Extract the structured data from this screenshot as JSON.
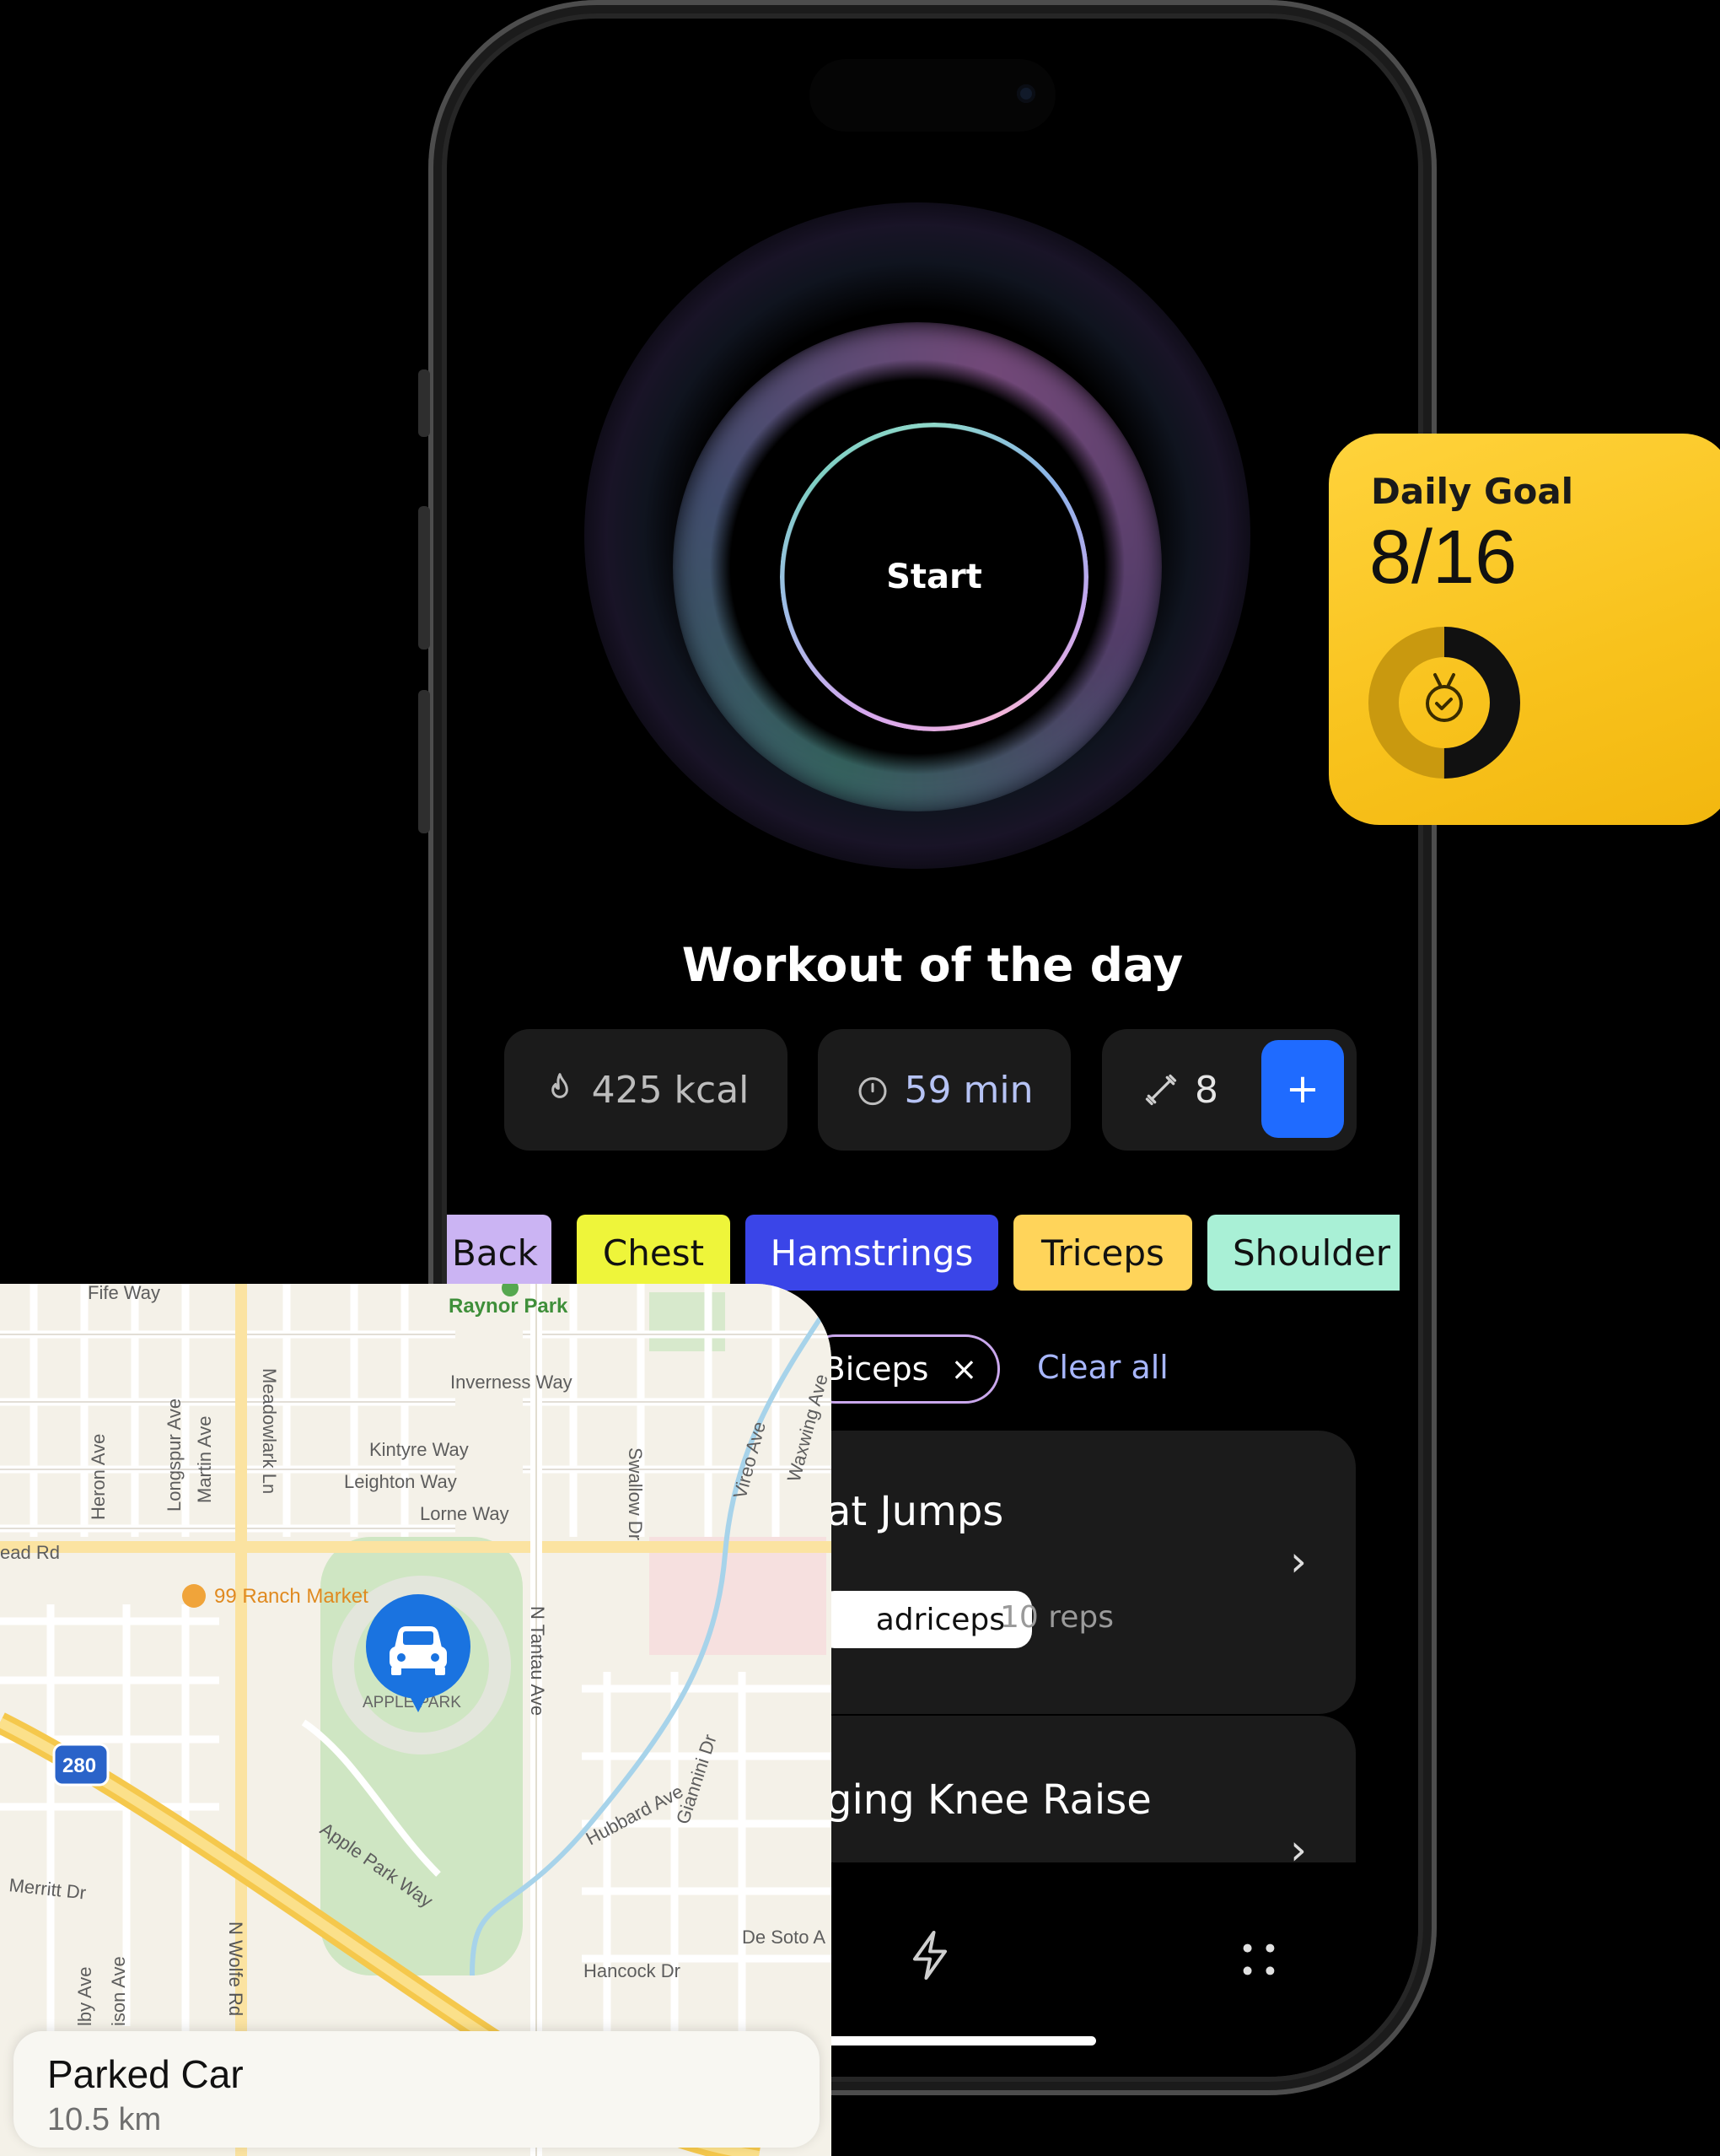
{
  "workout": {
    "start_label": "Start",
    "title": "Workout of the day",
    "stats": {
      "kcal": "425 kcal",
      "minutes": "59 min",
      "exercises": "8",
      "add_label": "+"
    },
    "categories": [
      {
        "label": "Back",
        "color": "#cbb4f3"
      },
      {
        "label": "Chest",
        "color": "#eef53a"
      },
      {
        "label": "Hamstrings",
        "color": "#3a45e8"
      },
      {
        "label": "Triceps",
        "color": "#ffd45a"
      },
      {
        "label": "Shoulder",
        "color": "#a9f0d6"
      }
    ],
    "active_filter": {
      "label": "Biceps",
      "remove_icon": "×"
    },
    "clear_all": "Clear all",
    "exercises": [
      {
        "title": "at Jumps",
        "tag": "adriceps",
        "reps": "10 reps"
      },
      {
        "title": "ging Knee Raise"
      }
    ],
    "tab_icons": [
      "lightning-icon",
      "grid-dots-icon"
    ]
  },
  "daily_goal": {
    "label": "Daily Goal",
    "value": "8/16",
    "progress": 0.5,
    "icon": "medal-icon"
  },
  "map": {
    "labels": {
      "fife": "Fife Way",
      "raynor": "Raynor Park",
      "inverness": "Inverness Way",
      "kintyre": "Kintyre Way",
      "leighton": "Leighton Way",
      "lorne": "Lorne Way",
      "heron": "Heron Ave",
      "longspur": "Longspur Ave",
      "martin": "Martin Ave",
      "meadowlark": "Meadowlark Ln",
      "swallow": "Swallow Dr",
      "vireo": "Vireo Ave",
      "waxwing": "Waxwing Ave",
      "homestead": "ead Rd",
      "ranch": "99 Ranch Market",
      "apple_park": "APPLE PARK",
      "tantau": "N Tantau Ave",
      "shield": "280",
      "hubbard": "Hubbard Ave",
      "giannini": "Giannini Dr",
      "merritt": "Merritt Dr",
      "applepark_way": "Apple Park Way",
      "desoto": "De Soto A",
      "hancock": "Hancock Dr",
      "wolfe": "N Wolfe Rd",
      "kilby": "lby Ave",
      "madison": "ison Ave"
    },
    "pin_icon": "car-icon",
    "parked": {
      "title": "Parked Car",
      "distance": "10.5 km"
    }
  }
}
